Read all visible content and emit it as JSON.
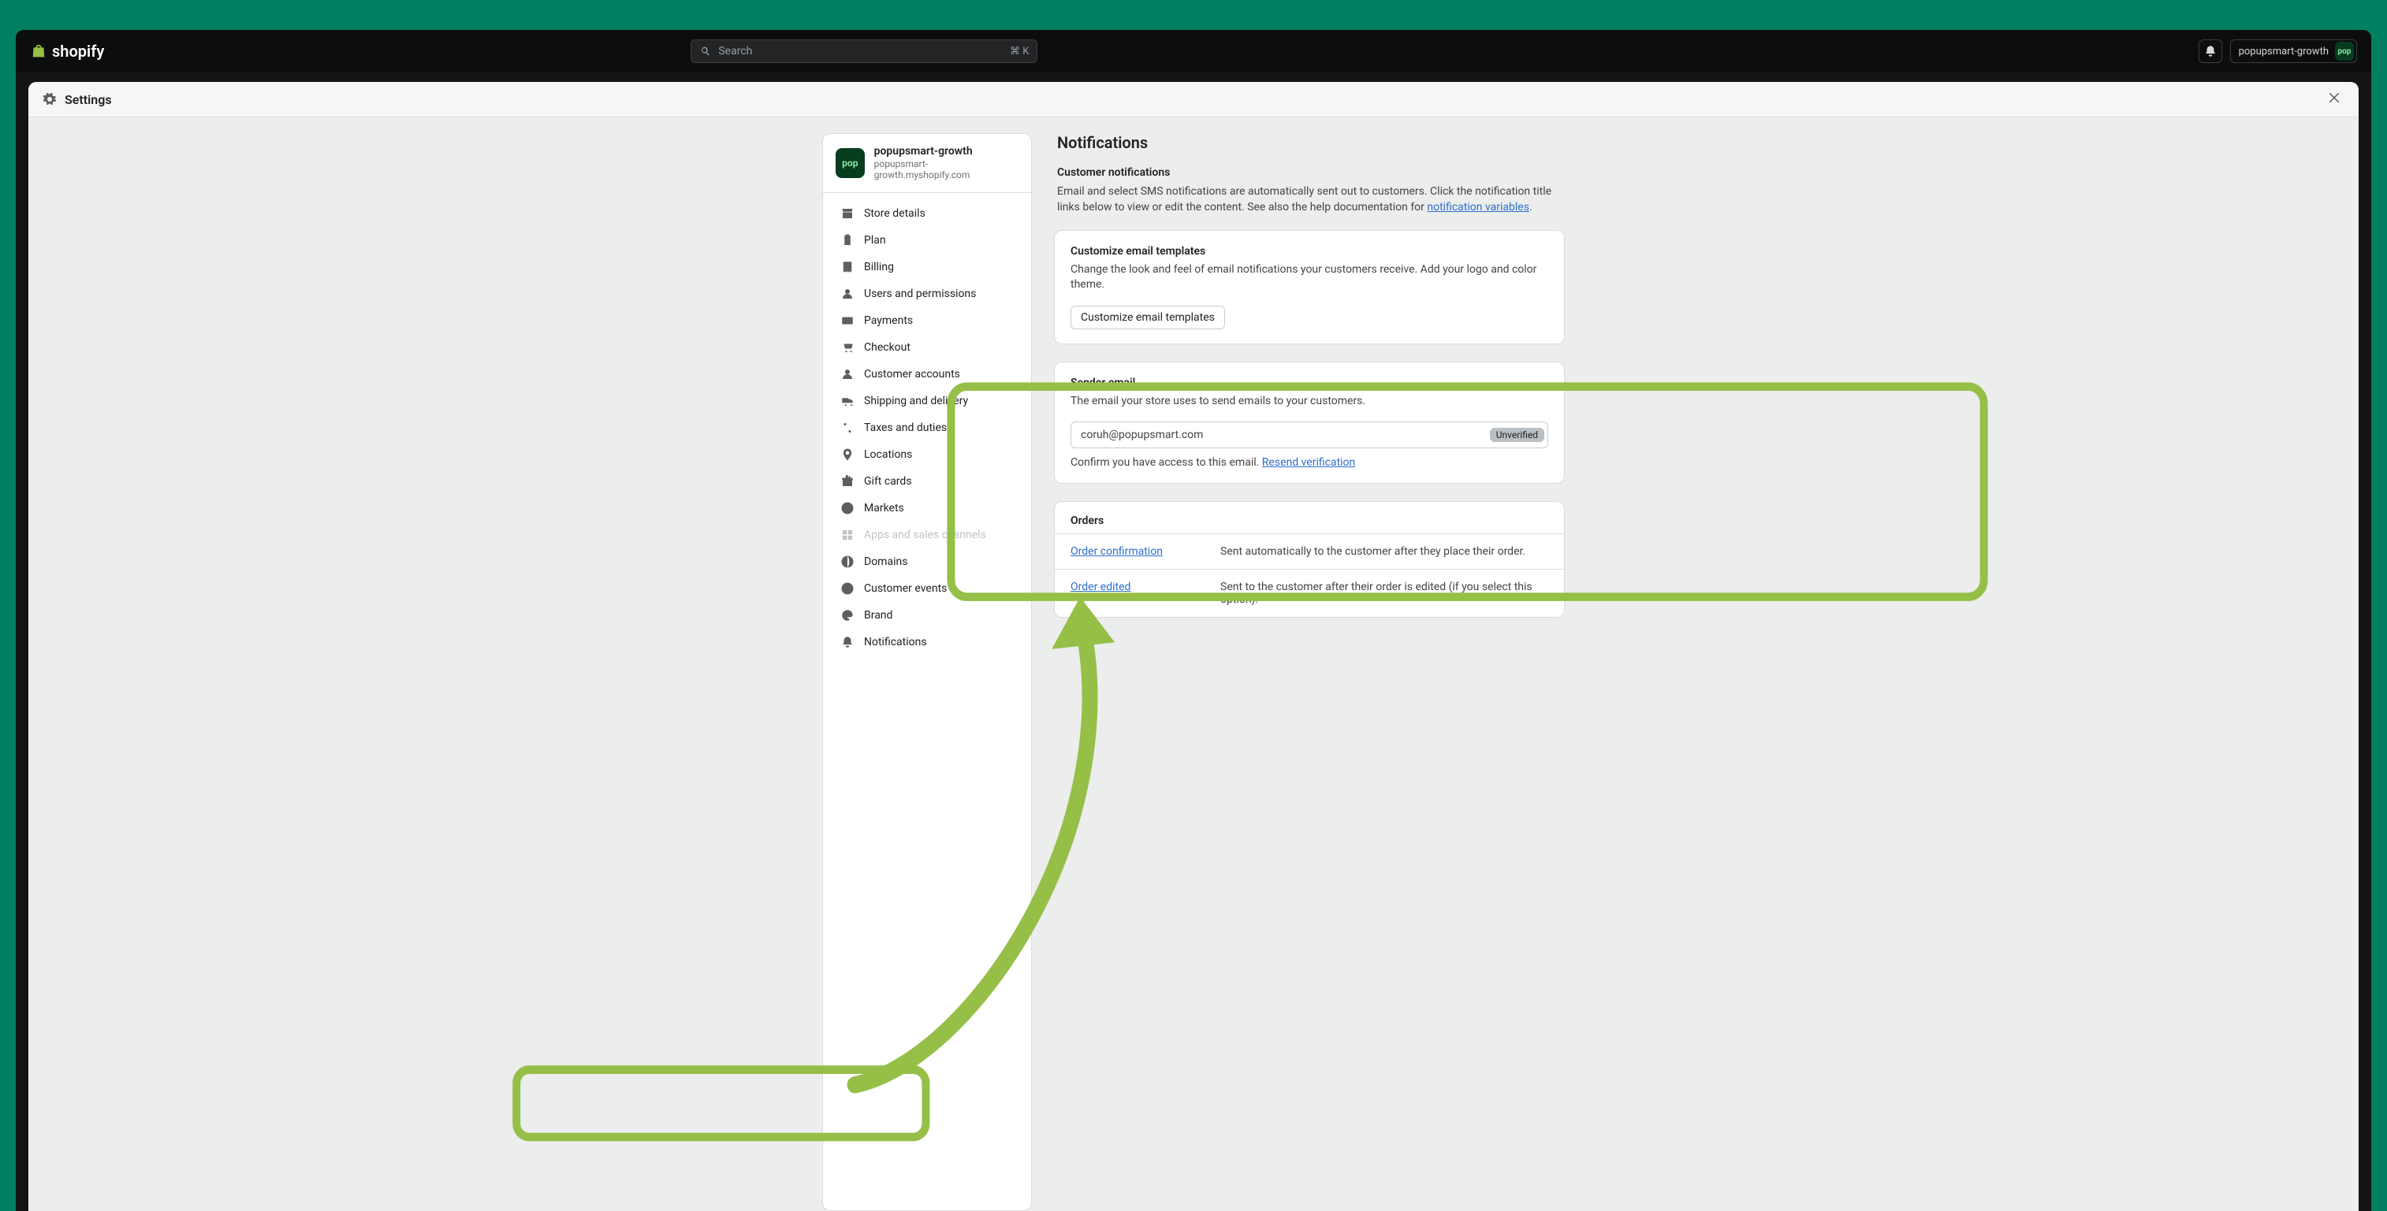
{
  "topbar": {
    "logo_text": "shopify",
    "search_placeholder": "Search",
    "shortcut": "⌘ K",
    "store_name": "popupsmart-growth",
    "avatar_text": "pop"
  },
  "modal": {
    "title": "Settings"
  },
  "store": {
    "avatar_text": "pop",
    "name": "popupsmart-growth",
    "url": "popupsmart-growth.myshopify.com"
  },
  "sidebar": {
    "store_details": "Store details",
    "plan": "Plan",
    "billing": "Billing",
    "users": "Users and permissions",
    "payments": "Payments",
    "checkout": "Checkout",
    "customer_accounts": "Customer accounts",
    "shipping": "Shipping and delivery",
    "taxes": "Taxes and duties",
    "locations": "Locations",
    "gift_cards": "Gift cards",
    "markets": "Markets",
    "apps": "Apps and sales channels",
    "domains": "Domains",
    "customer_events": "Customer events",
    "brand": "Brand",
    "notifications": "Notifications"
  },
  "main": {
    "page_title": "Notifications",
    "customer_h": "Customer notifications",
    "customer_p1": "Email and select SMS notifications are automatically sent out to customers. Click the notification title links below to view or edit the content. See also the help documentation for ",
    "variables_link": "notification variables",
    "period": ".",
    "cet_h": "Customize email templates",
    "cet_p": "Change the look and feel of email notifications your customers receive. Add your logo and color theme.",
    "cet_btn": "Customize email templates",
    "sender_h": "Sender email",
    "sender_p": "The email your store uses to send emails to your customers.",
    "sender_value": "coruh@popupsmart.com",
    "badge": "Unverified",
    "confirm_text": "Confirm you have access to this email. ",
    "resend_link": "Resend verification",
    "orders_h": "Orders",
    "rows": [
      {
        "link": "Order confirmation",
        "desc": "Sent automatically to the customer after they place their order."
      },
      {
        "link": "Order edited",
        "desc": "Sent to the customer after their order is edited (if you select this option)."
      }
    ]
  }
}
